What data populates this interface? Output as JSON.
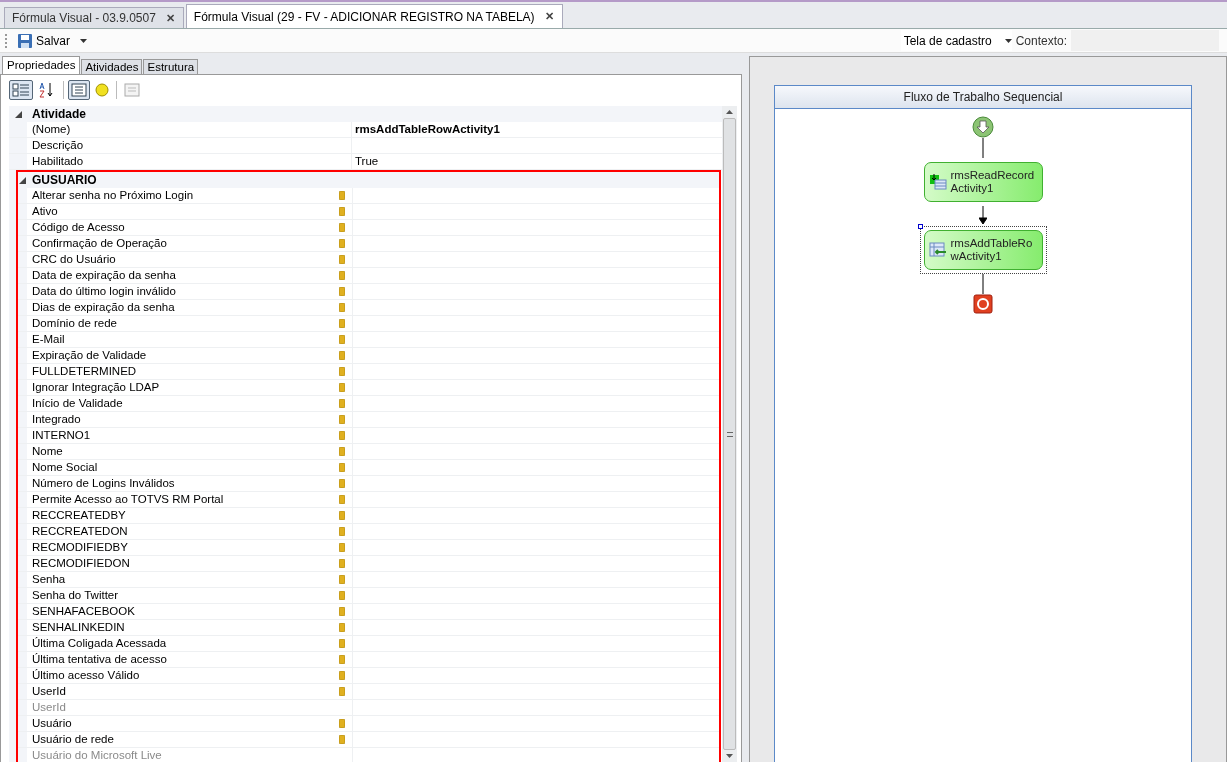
{
  "doc_tabs": [
    {
      "label": "Fórmula Visual - 03.9.0507",
      "close": "✕",
      "selected": false
    },
    {
      "label": "Fórmula Visual (29 - FV - ADICIONAR REGISTRO NA TABELA)",
      "close": "✕",
      "selected": true
    }
  ],
  "toolbar": {
    "save": "Salvar",
    "view_select": "Tela de cadastro",
    "context_label": "Contexto:"
  },
  "panel_tabs": [
    {
      "label": "Propriedades",
      "selected": true
    },
    {
      "label": "Atividades",
      "selected": false
    },
    {
      "label": "Estrutura",
      "selected": false
    }
  ],
  "property_toolbar": [
    {
      "kind": "categorized",
      "selected": true
    },
    {
      "kind": "alphabetical",
      "selected": false
    },
    {
      "kind": "properties",
      "selected": true
    },
    {
      "kind": "fields",
      "selected": false
    },
    {
      "kind": "pages",
      "selected": false
    }
  ],
  "properties": [
    {
      "category": "Atividade",
      "expanded": true,
      "highlighted": false,
      "items": [
        {
          "name": "(Nome)",
          "value": "rmsAddTableRowActivity1",
          "disabled": false
        },
        {
          "name": "Descrição",
          "disabled": false
        },
        {
          "name": "Habilitado",
          "value": "True",
          "disabled": false
        }
      ]
    },
    {
      "category": "GUSUARIO",
      "expanded": true,
      "highlighted": true,
      "items": [
        {
          "name": "Alterar senha no Próximo Login",
          "bound": true,
          "disabled": false
        },
        {
          "name": "Ativo",
          "bound": true,
          "disabled": false
        },
        {
          "name": "Código de Acesso",
          "bound": true,
          "disabled": false
        },
        {
          "name": "Confirmação de Operação",
          "bound": true,
          "disabled": false
        },
        {
          "name": "CRC do Usuário",
          "bound": true,
          "disabled": false
        },
        {
          "name": "Data de expiração da senha",
          "bound": true,
          "disabled": false
        },
        {
          "name": "Data do último login inválido",
          "bound": true,
          "disabled": false
        },
        {
          "name": "Dias de expiração da senha",
          "bound": true,
          "disabled": false
        },
        {
          "name": "Domínio de rede",
          "bound": true,
          "disabled": false
        },
        {
          "name": "E-Mail",
          "bound": true,
          "disabled": false
        },
        {
          "name": "Expiração de Validade",
          "bound": true,
          "disabled": false
        },
        {
          "name": "FULLDETERMINED",
          "bound": true,
          "disabled": false
        },
        {
          "name": "Ignorar Integração LDAP",
          "bound": true,
          "disabled": false
        },
        {
          "name": "Início de Validade",
          "bound": true,
          "disabled": false
        },
        {
          "name": "Integrado",
          "bound": true,
          "disabled": false
        },
        {
          "name": "INTERNO1",
          "bound": true,
          "disabled": false
        },
        {
          "name": "Nome",
          "bound": true,
          "disabled": false
        },
        {
          "name": "Nome Social",
          "bound": true,
          "disabled": false
        },
        {
          "name": "Número de Logins Inválidos",
          "bound": true,
          "disabled": false
        },
        {
          "name": "Permite Acesso ao TOTVS RM Portal",
          "bound": true,
          "disabled": false
        },
        {
          "name": "RECCREATEDBY",
          "bound": true,
          "disabled": false
        },
        {
          "name": "RECCREATEDON",
          "bound": true,
          "disabled": false
        },
        {
          "name": "RECMODIFIEDBY",
          "bound": true,
          "disabled": false
        },
        {
          "name": "RECMODIFIEDON",
          "bound": true,
          "disabled": false
        },
        {
          "name": "Senha",
          "bound": true,
          "disabled": false
        },
        {
          "name": "Senha do Twitter",
          "bound": true,
          "disabled": false
        },
        {
          "name": "SENHAFACEBOOK",
          "bound": true,
          "disabled": false
        },
        {
          "name": "SENHALINKEDIN",
          "bound": true,
          "disabled": false
        },
        {
          "name": "Última Coligada Acessada",
          "bound": true,
          "disabled": false
        },
        {
          "name": "Última tentativa de acesso",
          "bound": true,
          "disabled": false
        },
        {
          "name": "Último acesso Válido",
          "bound": true,
          "disabled": false
        },
        {
          "name": "UserId",
          "bound": true,
          "disabled": false
        },
        {
          "name": "UserId",
          "bound": false,
          "disabled": true
        },
        {
          "name": "Usuário",
          "bound": true,
          "disabled": false
        },
        {
          "name": "Usuário de rede",
          "bound": true,
          "disabled": false
        },
        {
          "name": "Usuário do Microsoft Live",
          "bound": false,
          "disabled": true
        }
      ]
    }
  ],
  "workflow": {
    "title": "Fluxo de Trabalho Sequencial",
    "nodes": [
      {
        "kind": "start"
      },
      {
        "kind": "read",
        "label": "rmsReadRecordActivity1",
        "selected": false
      },
      {
        "kind": "add",
        "label": "rmsAddTableRowActivity1",
        "selected": true
      },
      {
        "kind": "end"
      }
    ]
  }
}
